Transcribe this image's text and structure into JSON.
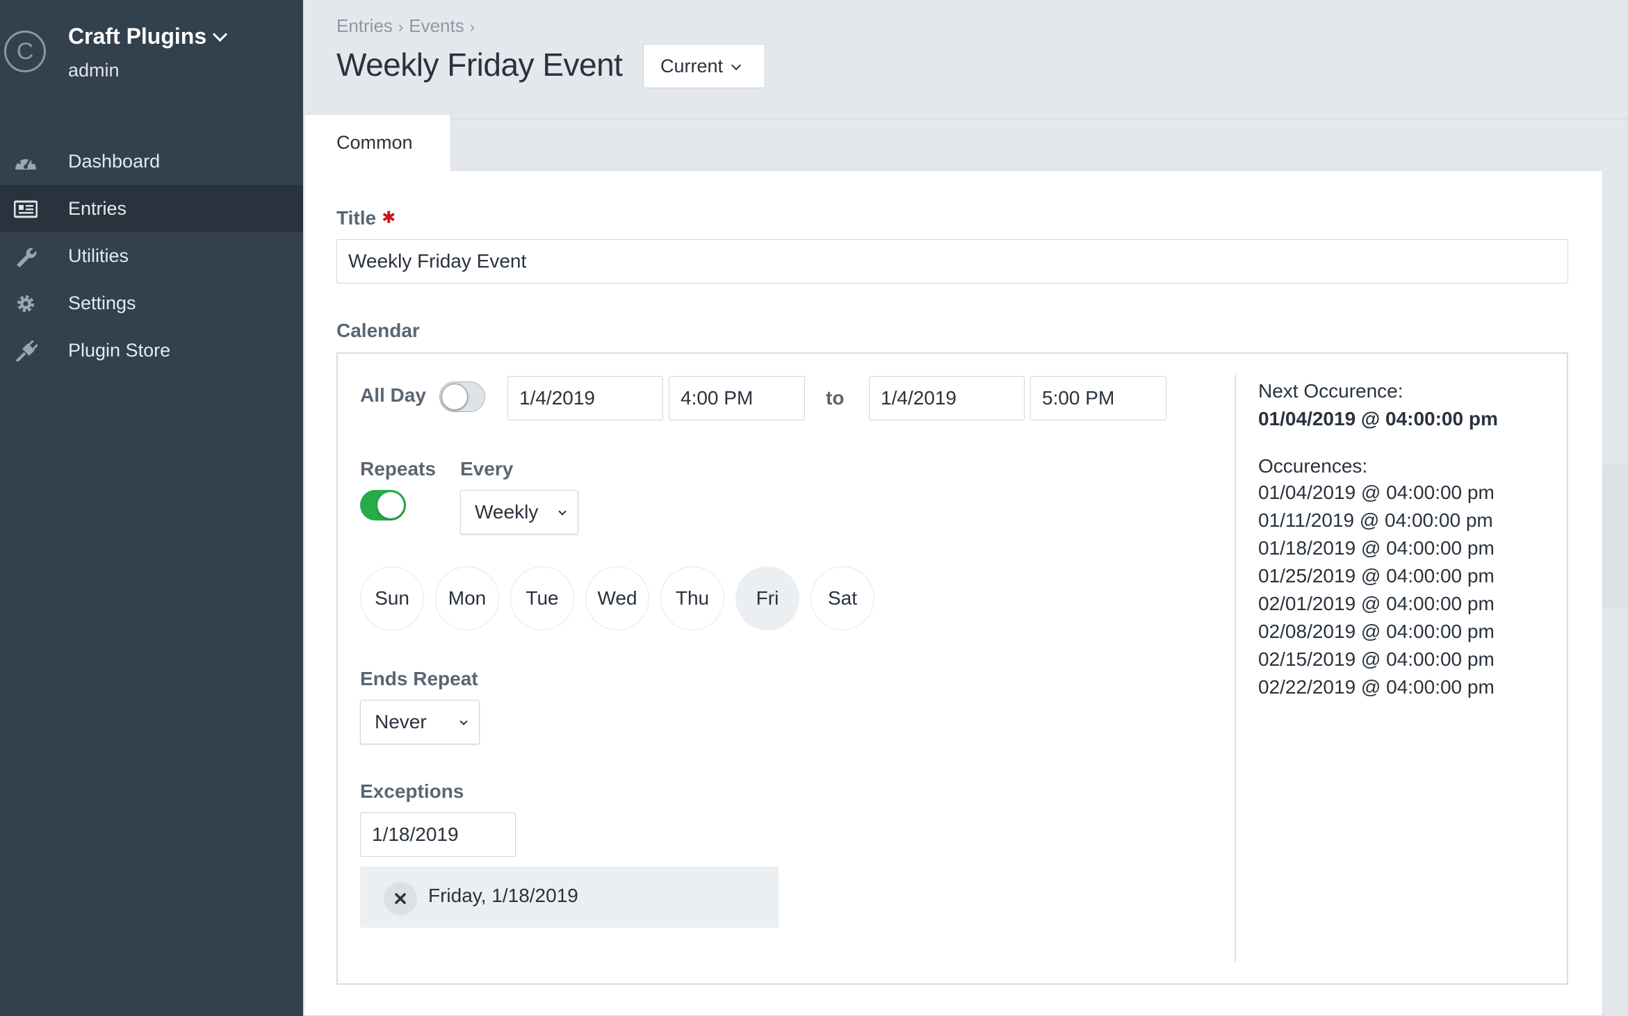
{
  "sidebar": {
    "site_logo": "C",
    "site_name": "Craft Plugins",
    "user": "admin",
    "items": [
      {
        "label": "Dashboard",
        "icon": "dashboard-icon"
      },
      {
        "label": "Entries",
        "icon": "entries-icon",
        "active": true
      },
      {
        "label": "Utilities",
        "icon": "wrench-icon"
      },
      {
        "label": "Settings",
        "icon": "gear-icon"
      },
      {
        "label": "Plugin Store",
        "icon": "plug-icon"
      }
    ]
  },
  "header": {
    "breadcrumb": [
      "Entries",
      "Events"
    ],
    "title": "Weekly Friday Event",
    "revision": "Current"
  },
  "tabs": [
    "Common"
  ],
  "fields": {
    "title_label": "Title",
    "title_value": "Weekly Friday Event",
    "calendar_label": "Calendar"
  },
  "calendar": {
    "all_day_label": "All Day",
    "all_day": false,
    "start_date": "1/4/2019",
    "start_time": "4:00 PM",
    "to_label": "to",
    "end_date": "1/4/2019",
    "end_time": "5:00 PM",
    "repeats_label": "Repeats",
    "repeats": true,
    "every_label": "Every",
    "frequency": "Weekly",
    "days": [
      "Sun",
      "Mon",
      "Tue",
      "Wed",
      "Thu",
      "Fri",
      "Sat"
    ],
    "selected_day": "Fri",
    "ends_repeat_label": "Ends Repeat",
    "ends_repeat": "Never",
    "exceptions_label": "Exceptions",
    "exception_input": "1/18/2019",
    "exception_item": "Friday, 1/18/2019",
    "next_occurrence_label": "Next Occurence:",
    "next_occurrence": "01/04/2019 @ 04:00:00 pm",
    "occurrences_label": "Occurences:",
    "occurrences": [
      "01/04/2019 @ 04:00:00 pm",
      "01/11/2019 @ 04:00:00 pm",
      "01/18/2019 @ 04:00:00 pm",
      "01/25/2019 @ 04:00:00 pm",
      "02/01/2019 @ 04:00:00 pm",
      "02/08/2019 @ 04:00:00 pm",
      "02/15/2019 @ 04:00:00 pm",
      "02/22/2019 @ 04:00:00 pm"
    ]
  },
  "colors": {
    "sidebar_bg": "#33404d",
    "sidebar_active": "#29323d",
    "page_bg": "#e4e8ec",
    "toggle_on": "#27ab48",
    "required": "#cf1124"
  }
}
